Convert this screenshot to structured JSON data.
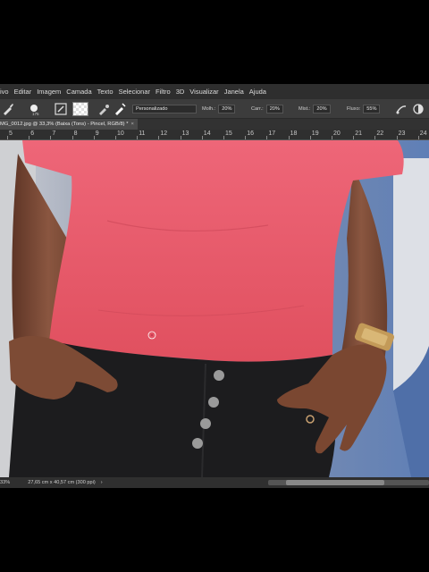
{
  "menu": [
    "ivo",
    "Editar",
    "Imagem",
    "Camada",
    "Texto",
    "Selecionar",
    "Filtro",
    "3D",
    "Visualizar",
    "Janela",
    "Ajuda"
  ],
  "options": {
    "brush_size": "175",
    "preset": "Personalizado",
    "mode_label": "Molh.:",
    "mode_value": "20%",
    "load_label": "Carr.:",
    "load_value": "20%",
    "mix_label": "Mist.:",
    "mix_value": "20%",
    "flow_label": "Fluxo:",
    "flow_value": "55%"
  },
  "document_tab": {
    "title": "MG_0012.jpg @ 33,3% (Baixa (Tons) - Pincel, RGB/8) *",
    "close": "×"
  },
  "ruler_ticks": [
    "5",
    "6",
    "7",
    "8",
    "9",
    "10",
    "11",
    "12",
    "13",
    "14",
    "15",
    "16",
    "17",
    "18",
    "19",
    "20",
    "21",
    "22",
    "23",
    "24"
  ],
  "status": {
    "zoom": "33%",
    "dimensions": "27,65 cm x 40,57 cm (300 ppi)",
    "arrow": "›"
  },
  "colors": {
    "shirt": "#e85a6c",
    "shorts": "#1d1d1f",
    "skin": "#7a4a36",
    "background": "#6a84b4",
    "accent": "#e8e8e8"
  }
}
